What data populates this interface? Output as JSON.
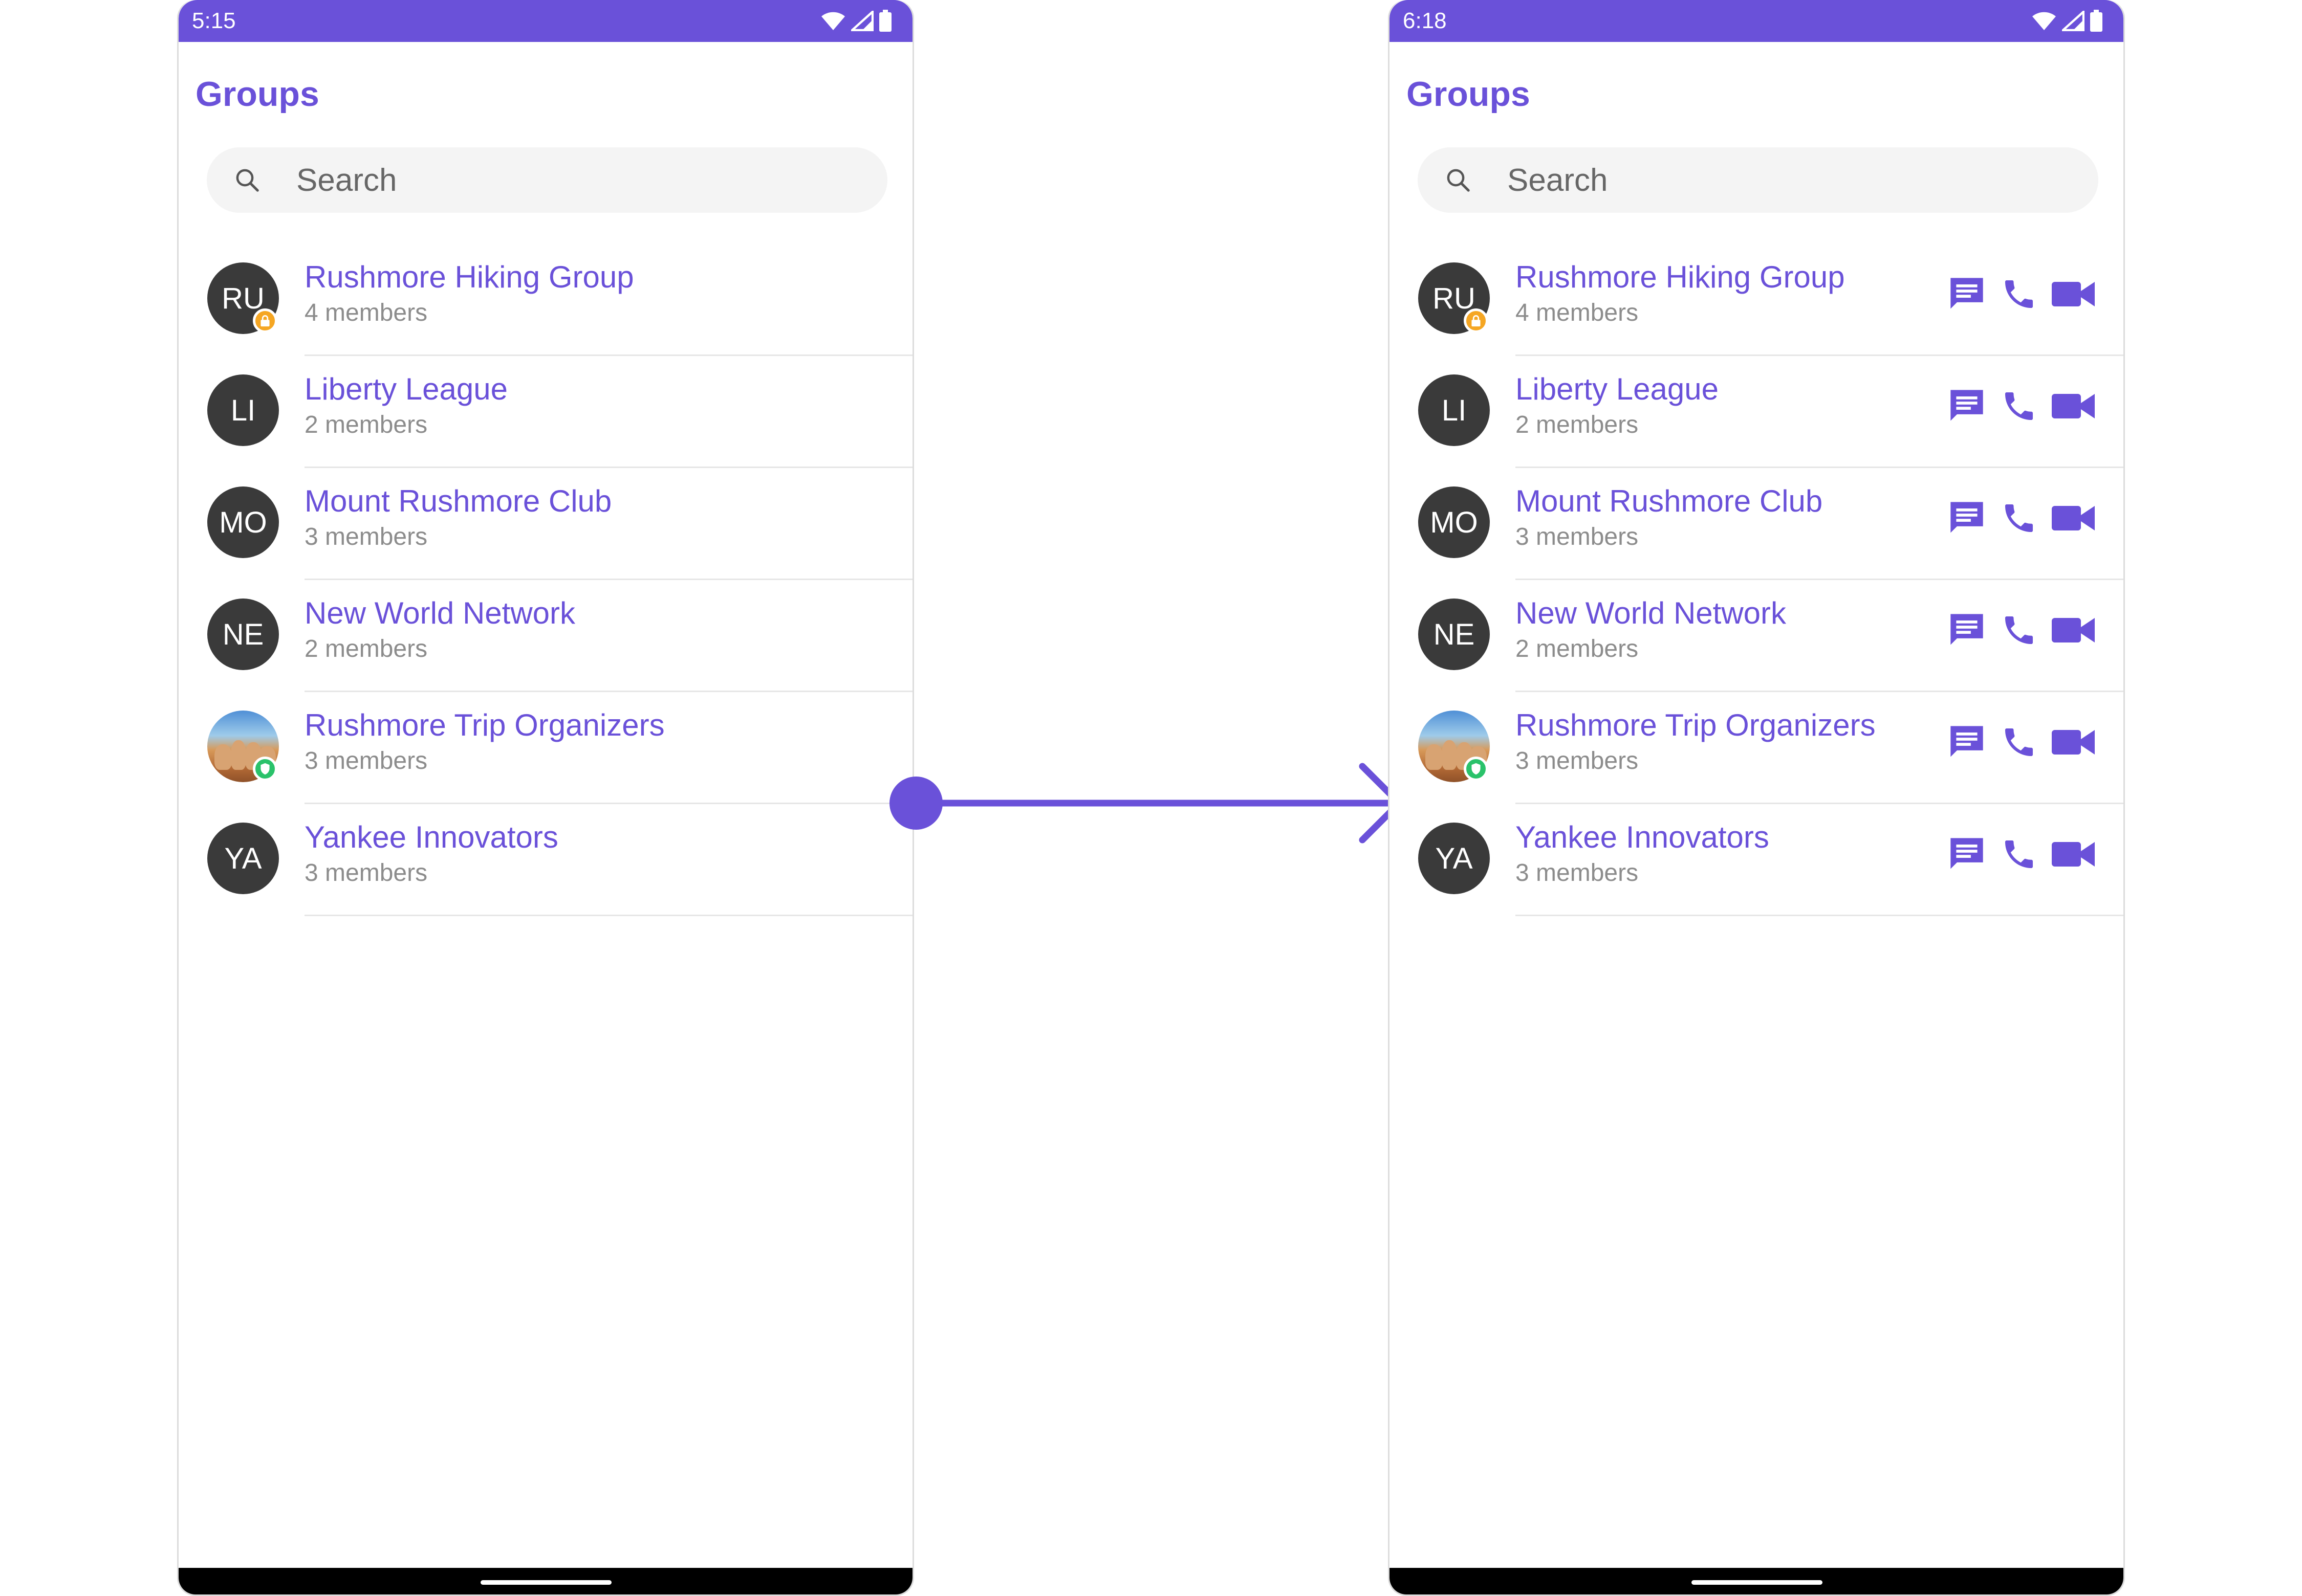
{
  "accent_color": "#6a51d9",
  "status_bar_color": "#6a51d9",
  "badge_colors": {
    "password": "#f5a623",
    "private": "#2ac26a"
  },
  "screens": [
    {
      "status_time": "5:15",
      "title": "Groups",
      "search_placeholder": "Search",
      "show_actions": false,
      "groups": [
        {
          "initials": "RU",
          "name": "Rushmore Hiking Group",
          "members": "4 members",
          "avatar": "initials",
          "badge": "password-lock-icon"
        },
        {
          "initials": "LI",
          "name": "Liberty League",
          "members": "2 members",
          "avatar": "initials",
          "badge": ""
        },
        {
          "initials": "MO",
          "name": "Mount Rushmore Club",
          "members": "3 members",
          "avatar": "initials",
          "badge": ""
        },
        {
          "initials": "NE",
          "name": "New World Network",
          "members": "2 members",
          "avatar": "initials",
          "badge": ""
        },
        {
          "initials": "",
          "name": "Rushmore Trip Organizers",
          "members": "3 members",
          "avatar": "photo",
          "badge": "private-shield-icon"
        },
        {
          "initials": "YA",
          "name": "Yankee Innovators",
          "members": "3 members",
          "avatar": "initials",
          "badge": ""
        }
      ]
    },
    {
      "status_time": "6:18",
      "title": "Groups",
      "search_placeholder": "Search",
      "show_actions": true,
      "action_icons": [
        "message-icon",
        "voice-call-icon",
        "video-call-icon"
      ],
      "groups": [
        {
          "initials": "RU",
          "name": "Rushmore Hiking Group",
          "members": "4 members",
          "avatar": "initials",
          "badge": "password-lock-icon"
        },
        {
          "initials": "LI",
          "name": "Liberty League",
          "members": "2 members",
          "avatar": "initials",
          "badge": ""
        },
        {
          "initials": "MO",
          "name": "Mount Rushmore Club",
          "members": "3 members",
          "avatar": "initials",
          "badge": ""
        },
        {
          "initials": "NE",
          "name": "New World Network",
          "members": "2 members",
          "avatar": "initials",
          "badge": ""
        },
        {
          "initials": "",
          "name": "Rushmore Trip Organizers",
          "members": "3 members",
          "avatar": "photo",
          "badge": "private-shield-icon"
        },
        {
          "initials": "YA",
          "name": "Yankee Innovators",
          "members": "3 members",
          "avatar": "initials",
          "badge": ""
        }
      ]
    }
  ],
  "status_icons": [
    "wifi-icon",
    "signal-icon",
    "battery-icon"
  ]
}
